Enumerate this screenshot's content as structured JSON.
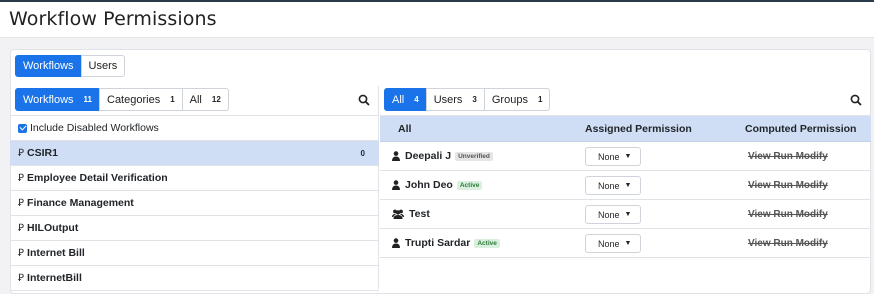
{
  "header": {
    "title": "Workflow Permissions"
  },
  "mode_tabs": [
    {
      "label": "Workflows",
      "active": true
    },
    {
      "label": "Users",
      "active": false
    }
  ],
  "left_filters": [
    {
      "label": "Workflows",
      "count": "11",
      "active": true
    },
    {
      "label": "Categories",
      "count": "1",
      "active": false
    },
    {
      "label": "All",
      "count": "12",
      "active": false
    }
  ],
  "include_disabled": {
    "label": "Include Disabled Workflows",
    "checked": true
  },
  "workflows": [
    {
      "name": "CSIR1",
      "count": "0",
      "selected": true
    },
    {
      "name": "Employee Detail Verification",
      "count": "",
      "selected": false
    },
    {
      "name": "Finance Management",
      "count": "",
      "selected": false
    },
    {
      "name": "HILOutput",
      "count": "",
      "selected": false
    },
    {
      "name": "Internet Bill",
      "count": "",
      "selected": false
    },
    {
      "name": "InternetBill",
      "count": "",
      "selected": false
    }
  ],
  "right_filters": [
    {
      "label": "All",
      "count": "4",
      "active": true
    },
    {
      "label": "Users",
      "count": "3",
      "active": false
    },
    {
      "label": "Groups",
      "count": "1",
      "active": false
    }
  ],
  "table": {
    "col_all": "All",
    "col_assigned": "Assigned Permission",
    "col_computed": "Computed Permission",
    "rows": [
      {
        "name": "Deepali J",
        "icon": "user-icon",
        "status": "Unverified",
        "status_type": "unverified",
        "assigned": "None",
        "computed": "View Run Modify"
      },
      {
        "name": "John Deo",
        "icon": "user-icon",
        "status": "Active",
        "status_type": "active",
        "assigned": "None",
        "computed": "View Run Modify"
      },
      {
        "name": "Test",
        "icon": "users-icon",
        "status": "",
        "status_type": "",
        "assigned": "None",
        "computed": "View Run Modify"
      },
      {
        "name": "Trupti Sardar",
        "icon": "user-icon",
        "status": "Active",
        "status_type": "active",
        "assigned": "None",
        "computed": "View Run Modify"
      }
    ]
  },
  "colors": {
    "primary": "#1a73e8",
    "selected_row": "#cfdef5"
  }
}
